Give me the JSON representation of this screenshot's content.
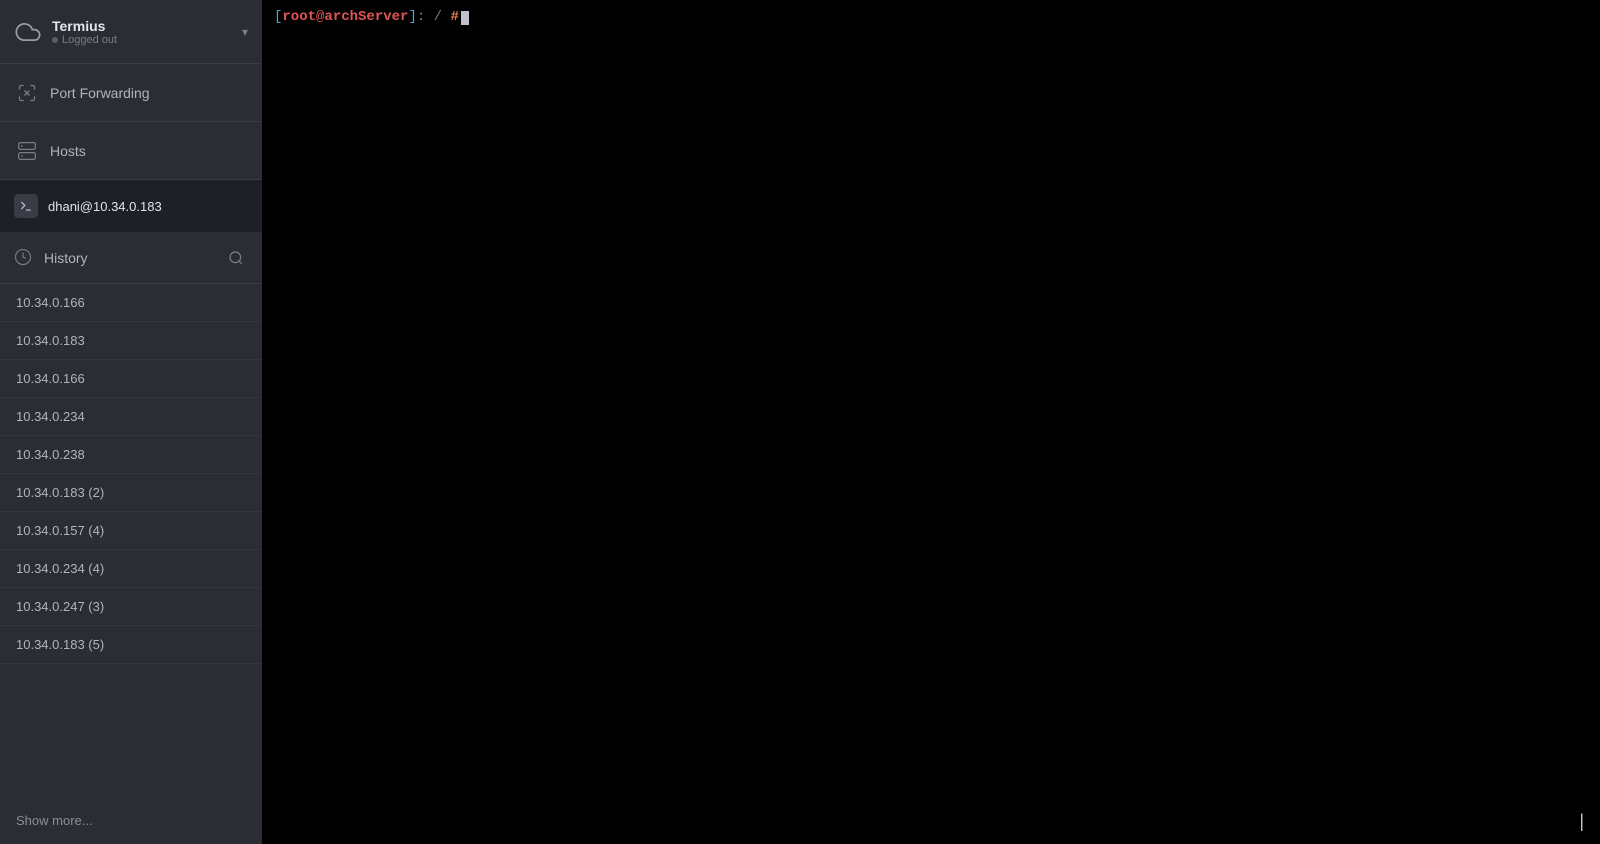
{
  "app": {
    "title": "Termius",
    "status": "Logged out",
    "chevron": "▾"
  },
  "nav": {
    "port_forwarding": "Port Forwarding",
    "hosts": "Hosts"
  },
  "session": {
    "label": "dhani@10.34.0.183"
  },
  "history": {
    "label": "History",
    "items": [
      "10.34.0.166",
      "10.34.0.183",
      "10.34.0.166",
      "10.34.0.234",
      "10.34.0.238",
      "10.34.0.183 (2)",
      "10.34.0.157 (4)",
      "10.34.0.234 (4)",
      "10.34.0.247 (3)",
      "10.34.0.183 (5)"
    ],
    "show_more": "Show more..."
  },
  "terminal": {
    "bracket_open": "[",
    "root": "root",
    "at": "@",
    "host": "archServer",
    "bracket_close": "]",
    "path": ": /",
    "hash": "#"
  }
}
